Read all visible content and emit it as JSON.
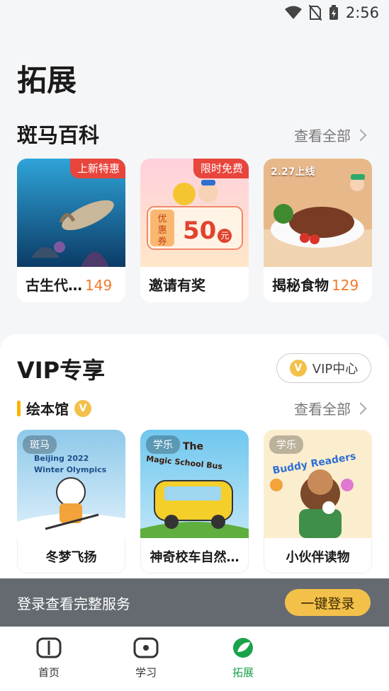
{
  "status": {
    "time": "2:56"
  },
  "page_title": "拓展",
  "zebra_wiki": {
    "title": "斑马百科",
    "see_all": "查看全部",
    "cards": [
      {
        "label": "古生代…",
        "count": "149",
        "badge": "上新特惠"
      },
      {
        "label": "邀请有奖",
        "badge": "限时免费",
        "coupon_tag": "优惠券",
        "coupon_value": "50",
        "coupon_unit": "元"
      },
      {
        "label": "揭秘食物",
        "count": "129",
        "corner_text": "2.27上线"
      }
    ]
  },
  "vip": {
    "title": "VIP专享",
    "center_button": "VIP中心",
    "v_badge": "V",
    "picture_books": {
      "title": "绘本馆",
      "see_all": "查看全部",
      "books": [
        {
          "tag": "斑马",
          "label": "冬梦飞扬",
          "cover_line1": "Beijing 2022",
          "cover_line2": "Winter Olympics"
        },
        {
          "tag": "学乐",
          "label": "神奇校车自然…",
          "cover_line1": "The",
          "cover_line2": "Magic School Bus"
        },
        {
          "tag": "学乐",
          "label": "小伙伴读物",
          "cover_line1": "Buddy Readers"
        }
      ]
    }
  },
  "login_bar": {
    "text": "登录查看完整服务",
    "button": "一键登录"
  },
  "tabbar": {
    "items": [
      {
        "label": "首页"
      },
      {
        "label": "学习"
      },
      {
        "label": "拓展"
      }
    ]
  },
  "colors": {
    "accent_green": "#1aa24a",
    "accent_orange": "#f07a2a",
    "badge_red": "#e8453c",
    "vip_gold": "#f3c04a"
  }
}
